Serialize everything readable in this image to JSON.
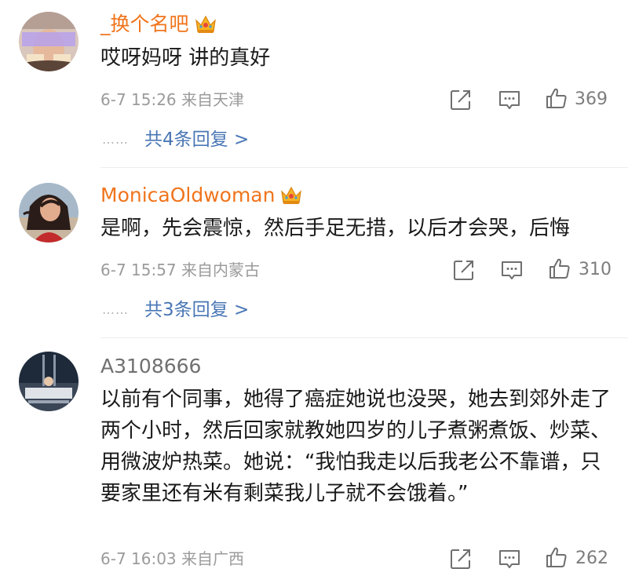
{
  "comments": [
    {
      "username": "_换个名吧",
      "vip": true,
      "text": "哎呀妈呀 讲的真好",
      "meta": "6-7 15:26  来自天津",
      "likes": "369",
      "replies_label": "共4条回复 >"
    },
    {
      "username": "MonicaOldwoman",
      "vip": true,
      "text": "是啊，先会震惊，然后手足无措，以后才会哭，后悔",
      "meta": "6-7 15:57  来自内蒙古",
      "likes": "310",
      "replies_label": "共3条回复 >"
    },
    {
      "username": "A3108666",
      "vip": false,
      "text": "以前有个同事，她得了癌症她说也没哭，她去到郊外走了两个小时，然后回家就教她四岁的儿子煮粥煮饭、炒菜、用微波炉热菜。她说：“我怕我走以后我老公不靠谱，只要家里还有米有剩菜我儿子就不会饿着。”",
      "meta": "6-7 16:03  来自广西",
      "likes": "262"
    }
  ],
  "icons": {
    "share": "share-icon",
    "comment": "comment-icon",
    "like": "thumbs-up-icon",
    "crown": "vip-crown-icon"
  },
  "colors": {
    "vip_name": "#f0741c",
    "reply_link": "#4a77b5",
    "meta": "#9b9b9b"
  }
}
